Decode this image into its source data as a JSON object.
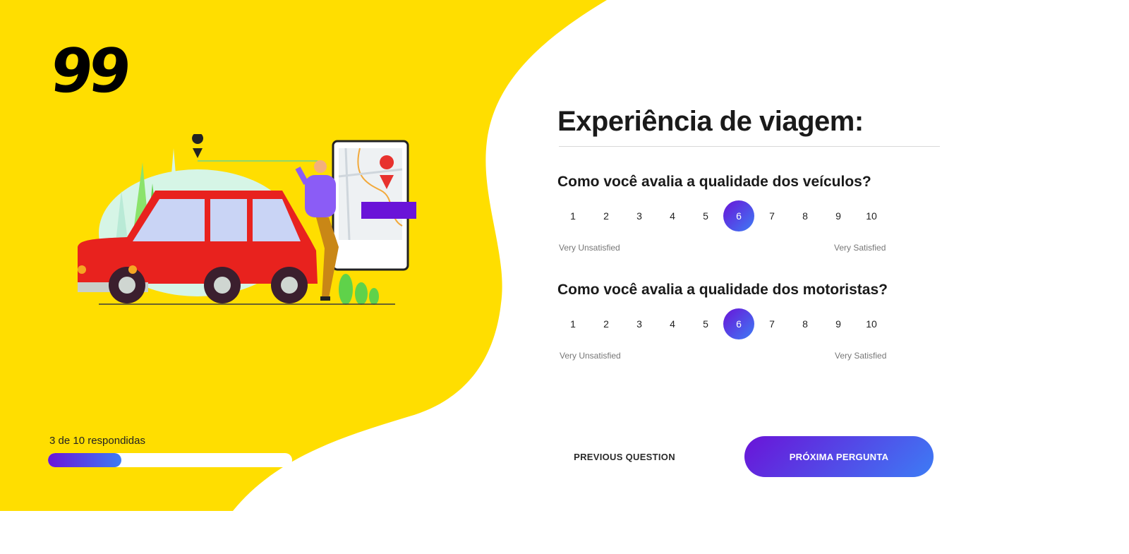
{
  "brand": {
    "logo_text": "99",
    "yellow": "#FFDE00",
    "accent_gradient_start": "#6A14D8",
    "accent_gradient_end": "#3D7CF5"
  },
  "progress": {
    "label": "3 de 10 respondidas",
    "answered": 3,
    "total": 10
  },
  "form": {
    "title": "Experiência de viagem:",
    "questions": [
      {
        "text": "Como você avalia a qualidade dos veículos?",
        "options": [
          "1",
          "2",
          "3",
          "4",
          "5",
          "6",
          "7",
          "8",
          "9",
          "10"
        ],
        "selected": "6",
        "min_label": "Very Unsatisfied",
        "max_label": "Very Satisfied"
      },
      {
        "text": "Como você avalia a qualidade dos motoristas?",
        "options": [
          "1",
          "2",
          "3",
          "4",
          "5",
          "6",
          "7",
          "8",
          "9",
          "10"
        ],
        "selected": "6",
        "min_label": "Very Unsatisfied",
        "max_label": "Very Satisfied"
      }
    ]
  },
  "nav": {
    "prev_label": "PREVIOUS QUESTION",
    "next_label": "PRÓXIMA PERGUNTA"
  },
  "illustration": {
    "icons": [
      "car-icon",
      "person-icon",
      "phone-map-icon",
      "location-pin-icon",
      "trees-icon",
      "plant-icon"
    ]
  }
}
